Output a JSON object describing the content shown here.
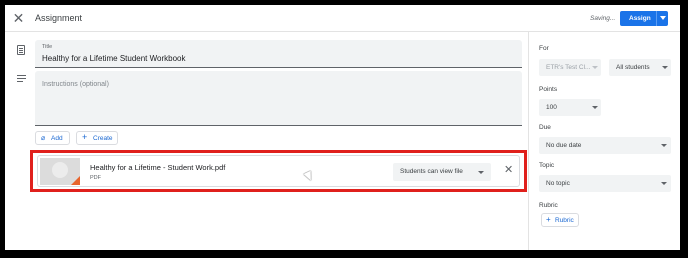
{
  "header": {
    "title": "Assignment",
    "saving_text": "Saving...",
    "assign_label": "Assign",
    "accent": "#1a73e8"
  },
  "form": {
    "title_label": "Title",
    "title_value": "Healthy for a Lifetime Student Workbook",
    "instructions_placeholder": "Instructions (optional)",
    "add_label": "Add",
    "create_label": "Create"
  },
  "attachment": {
    "name": "Healthy for a Lifetime - Student Work.pdf",
    "type": "PDF",
    "permission": "Students can view file",
    "highlight_color": "#e0201c"
  },
  "sidebar": {
    "for_label": "For",
    "class_value": "ETR's Test Cl...",
    "students_value": "All students",
    "points_label": "Points",
    "points_value": "100",
    "due_label": "Due",
    "due_value": "No due date",
    "topic_label": "Topic",
    "topic_value": "No topic",
    "rubric_label": "Rubric",
    "rubric_button": "Rubric"
  },
  "icons": [
    "close-icon",
    "dropdown-caret-icon",
    "assignment-doc-icon",
    "instructions-lines-icon",
    "attach-icon",
    "add-icon",
    "pdf-thumbnail-icon",
    "mouse-cursor-icon"
  ]
}
